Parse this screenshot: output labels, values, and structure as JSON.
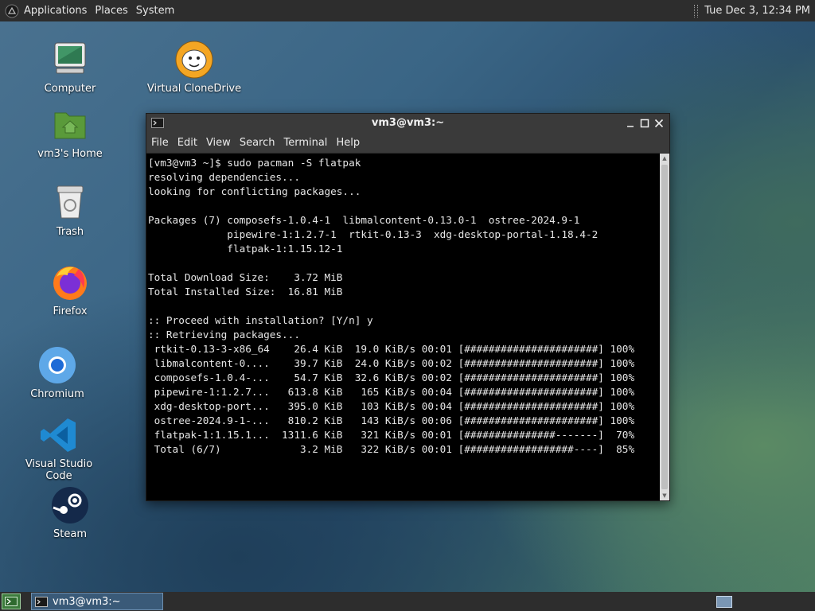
{
  "top_panel": {
    "menus": [
      "Applications",
      "Places",
      "System"
    ],
    "clock": "Tue Dec  3, 12:34 PM"
  },
  "desktop_icons": [
    {
      "label": "Computer",
      "icon": "computer-icon"
    },
    {
      "label": "vm3's Home",
      "icon": "home-folder-icon"
    },
    {
      "label": "Trash",
      "icon": "trash-icon"
    },
    {
      "label": "Firefox",
      "icon": "firefox-icon"
    },
    {
      "label": "Chromium",
      "icon": "chromium-icon"
    },
    {
      "label": "Visual Studio Code",
      "icon": "vscode-icon"
    },
    {
      "label": "Steam",
      "icon": "steam-icon"
    },
    {
      "label": "Virtual CloneDrive",
      "icon": "clonedrive-sheep-icon"
    }
  ],
  "terminal": {
    "title": "vm3@vm3:~",
    "menu": [
      "File",
      "Edit",
      "View",
      "Search",
      "Terminal",
      "Help"
    ],
    "lines": [
      "[vm3@vm3 ~]$ sudo pacman -S flatpak",
      "resolving dependencies...",
      "looking for conflicting packages...",
      "",
      "Packages (7) composefs-1.0.4-1  libmalcontent-0.13.0-1  ostree-2024.9-1",
      "             pipewire-1:1.2.7-1  rtkit-0.13-3  xdg-desktop-portal-1.18.4-2",
      "             flatpak-1:1.15.12-1",
      "",
      "Total Download Size:    3.72 MiB",
      "Total Installed Size:  16.81 MiB",
      "",
      ":: Proceed with installation? [Y/n] y",
      ":: Retrieving packages...",
      " rtkit-0.13-3-x86_64    26.4 KiB  19.0 KiB/s 00:01 [######################] 100%",
      " libmalcontent-0....    39.7 KiB  24.0 KiB/s 00:02 [######################] 100%",
      " composefs-1.0.4-...    54.7 KiB  32.6 KiB/s 00:02 [######################] 100%",
      " pipewire-1:1.2.7...   613.8 KiB   165 KiB/s 00:04 [######################] 100%",
      " xdg-desktop-port...   395.0 KiB   103 KiB/s 00:04 [######################] 100%",
      " ostree-2024.9-1-...   810.2 KiB   143 KiB/s 00:06 [######################] 100%",
      " flatpak-1:1.15.1...  1311.6 KiB   321 KiB/s 00:01 [###############-------]  70%",
      " Total (6/7)             3.2 MiB   322 KiB/s 00:01 [##################----]  85%"
    ]
  },
  "taskbar": {
    "task_label": "vm3@vm3:~"
  }
}
